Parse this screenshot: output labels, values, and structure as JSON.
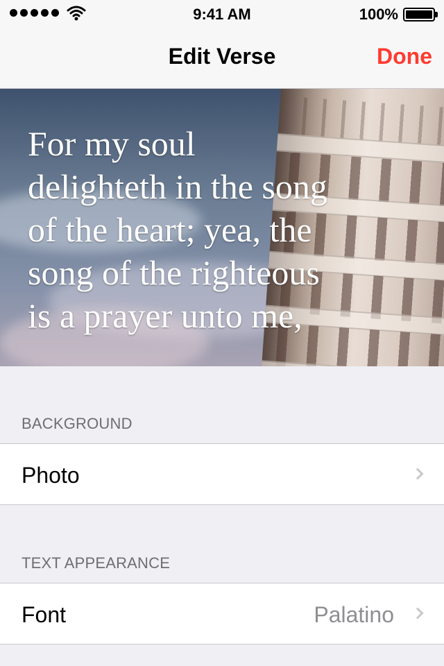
{
  "status_bar": {
    "signal_icon": "signal-dots-icon",
    "wifi_icon": "wifi-icon",
    "time": "9:41 AM",
    "battery_percentage": "100%",
    "battery_icon": "battery-full-icon"
  },
  "navigation": {
    "title": "Edit Verse",
    "done_label": "Done"
  },
  "verse": {
    "line1": "For my soul",
    "line2": "delighteth in the song",
    "line3": "of the heart; yea, the",
    "line4": "song of the righteous",
    "line5": "is a prayer unto me,"
  },
  "sections": {
    "background": {
      "header": "BACKGROUND",
      "row_label": "Photo"
    },
    "text_appearance": {
      "header": "TEXT APPEARANCE",
      "row_label": "Font",
      "row_value": "Palatino"
    }
  },
  "colors": {
    "accent": "#ff3b30",
    "grouped_background": "#efeff4",
    "secondary_text": "#8e8e93"
  }
}
